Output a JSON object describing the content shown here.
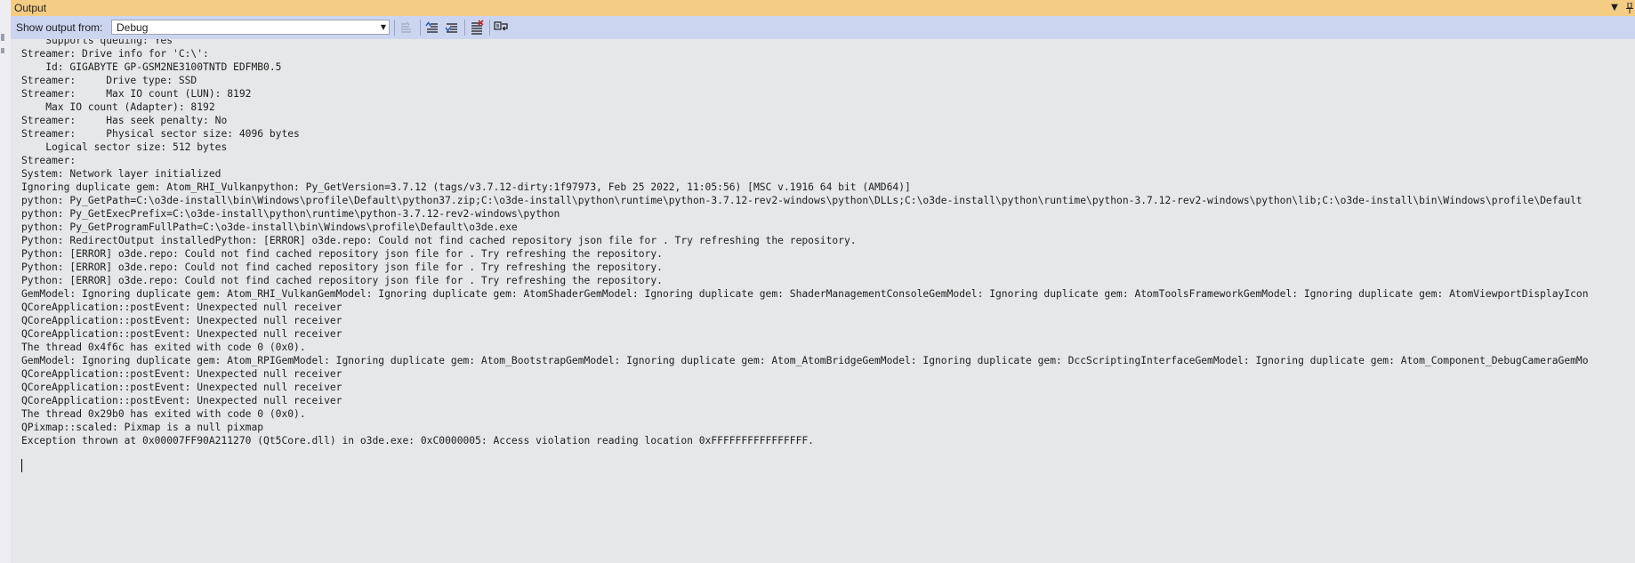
{
  "window": {
    "title": "Output"
  },
  "toolbar": {
    "show_output_label": "Show output from:",
    "source_value": "Debug"
  },
  "output_lines": [
    "    Supports queuing: Yes",
    "Streamer: Drive info for 'C:\\':",
    "    Id: GIGABYTE GP-GSM2NE3100TNTD EDFMB0.5",
    "Streamer:     Drive type: SSD",
    "Streamer:     Max IO count (LUN): 8192",
    "    Max IO count (Adapter): 8192",
    "Streamer:     Has seek penalty: No",
    "Streamer:     Physical sector size: 4096 bytes",
    "    Logical sector size: 512 bytes",
    "Streamer:",
    "System: Network layer initialized",
    "Ignoring duplicate gem: Atom_RHI_Vulkanpython: Py_GetVersion=3.7.12 (tags/v3.7.12-dirty:1f97973, Feb 25 2022, 11:05:56) [MSC v.1916 64 bit (AMD64)]",
    "python: Py_GetPath=C:\\o3de-install\\bin\\Windows\\profile\\Default\\python37.zip;C:\\o3de-install\\python\\runtime\\python-3.7.12-rev2-windows\\python\\DLLs;C:\\o3de-install\\python\\runtime\\python-3.7.12-rev2-windows\\python\\lib;C:\\o3de-install\\bin\\Windows\\profile\\Default",
    "python: Py_GetExecPrefix=C:\\o3de-install\\python\\runtime\\python-3.7.12-rev2-windows\\python",
    "python: Py_GetProgramFullPath=C:\\o3de-install\\bin\\Windows\\profile\\Default\\o3de.exe",
    "Python: RedirectOutput installedPython: [ERROR] o3de.repo: Could not find cached repository json file for . Try refreshing the repository.",
    "Python: [ERROR] o3de.repo: Could not find cached repository json file for . Try refreshing the repository.",
    "Python: [ERROR] o3de.repo: Could not find cached repository json file for . Try refreshing the repository.",
    "Python: [ERROR] o3de.repo: Could not find cached repository json file for . Try refreshing the repository.",
    "GemModel: Ignoring duplicate gem: Atom_RHI_VulkanGemModel: Ignoring duplicate gem: AtomShaderGemModel: Ignoring duplicate gem: ShaderManagementConsoleGemModel: Ignoring duplicate gem: AtomToolsFrameworkGemModel: Ignoring duplicate gem: AtomViewportDisplayIcon",
    "QCoreApplication::postEvent: Unexpected null receiver",
    "QCoreApplication::postEvent: Unexpected null receiver",
    "QCoreApplication::postEvent: Unexpected null receiver",
    "The thread 0x4f6c has exited with code 0 (0x0).",
    "GemModel: Ignoring duplicate gem: Atom_RPIGemModel: Ignoring duplicate gem: Atom_BootstrapGemModel: Ignoring duplicate gem: Atom_AtomBridgeGemModel: Ignoring duplicate gem: DccScriptingInterfaceGemModel: Ignoring duplicate gem: Atom_Component_DebugCameraGemMo",
    "QCoreApplication::postEvent: Unexpected null receiver",
    "QCoreApplication::postEvent: Unexpected null receiver",
    "QCoreApplication::postEvent: Unexpected null receiver",
    "The thread 0x29b0 has exited with code 0 (0x0).",
    "QPixmap::scaled: Pixmap is a null pixmap",
    "Exception thrown at 0x00007FF90A211270 (Qt5Core.dll) in o3de.exe: 0xC0000005: Access violation reading location 0xFFFFFFFFFFFFFFFF."
  ],
  "icons": {
    "find_previous": "find-previous-message-icon",
    "goto_previous": "go-to-previous-message-icon",
    "goto_next": "go-to-next-message-icon",
    "clear_all": "clear-all-icon",
    "word_wrap": "toggle-word-wrap-icon"
  }
}
